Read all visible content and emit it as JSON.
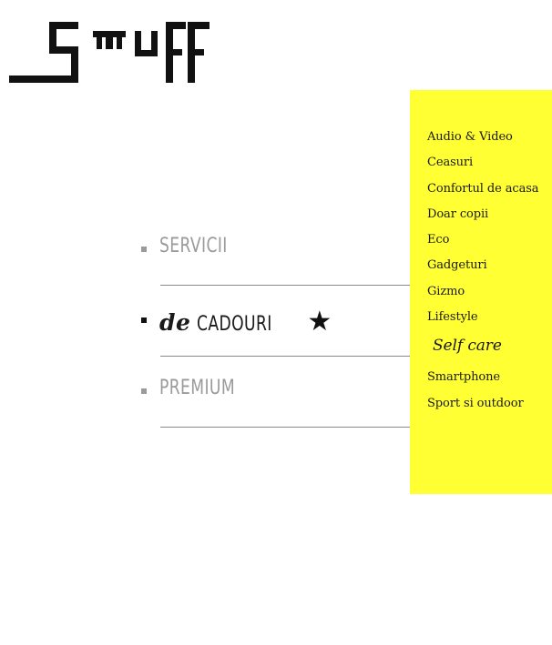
{
  "logo": {
    "alt": "Smuff"
  },
  "menu": {
    "items": [
      {
        "label": "SERVICII"
      },
      {
        "prefix": "de",
        "label": "CADOURI",
        "star": "★"
      },
      {
        "label": "PREMIUM"
      }
    ]
  },
  "dropdown": {
    "background": "#ffff33",
    "items": [
      "Audio & Video",
      "Ceasuri",
      "Confortul de acasa",
      "Doar copii",
      "Eco",
      "Gadgeturi",
      "Gizmo",
      "Lifestyle",
      "Self care",
      "Smartphone",
      "Sport si outdoor"
    ]
  }
}
